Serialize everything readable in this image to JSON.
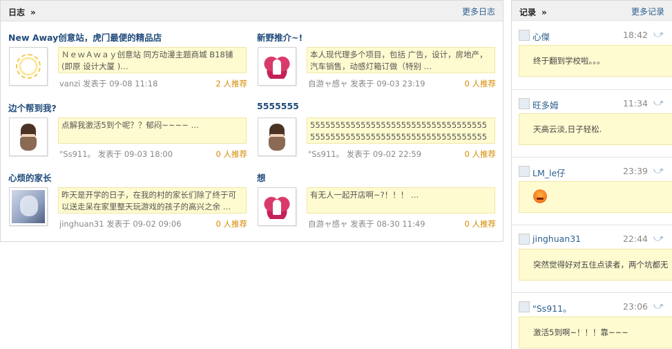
{
  "blog": {
    "title": "日志",
    "arrows": "»",
    "more": "更多日志",
    "posts": [
      {
        "title": "New Away创意站，虎门最便的精品店",
        "excerpt": "ＮｅｗＡｗａｙ创意站 同方动漫主题商城 B18铺(即原 设计大厦 )…",
        "author": "vanzi",
        "action": "发表于",
        "date": "09-08 11:18",
        "rec_num": "2",
        "rec_label": "人推荐",
        "avatar": "sun-icon"
      },
      {
        "title": "新野推介~!",
        "excerpt": "本人现代理多个项目，包括 广告，设计，房地产，汽车销售，动感灯箱订做（特别 …",
        "author": "自游ャ感ャ",
        "action": "发表于",
        "date": "09-03 23:19",
        "rec_num": "0",
        "rec_label": "人推荐",
        "avatar": "angel-icon"
      },
      {
        "title": "边个帮到我?",
        "excerpt": "点解我激活5到个呢？？郁闷~~~~ …",
        "author": "\"Ss911。",
        "action": "发表于",
        "date": "09-03 18:00",
        "rec_num": "0",
        "rec_label": "人推荐",
        "avatar": "boy-icon"
      },
      {
        "title": "5555555",
        "excerpt": "5555555555555555555555555555555555555555555555555555555555555555555555",
        "author": "\"Ss911。",
        "action": "发表于",
        "date": "09-02 22:59",
        "rec_num": "0",
        "rec_label": "人推荐",
        "avatar": "boy-icon"
      },
      {
        "title": "心烦的家长",
        "excerpt": "昨天是开学的日子，在我的村的家长们除了终于可以送走呆在家里整天玩游戏的孩子的高兴之余 …",
        "author": "jinghuan31",
        "action": "发表于",
        "date": "09-02 09:06",
        "rec_num": "0",
        "rec_label": "人推荐",
        "avatar": "girl-icon"
      },
      {
        "title": "想",
        "excerpt": "有无人一起开店啊~?！！！ …",
        "author": "自游ャ感ャ",
        "action": "发表于",
        "date": "08-30 11:49",
        "rec_num": "0",
        "rec_label": "人推荐",
        "avatar": "angel-icon"
      }
    ]
  },
  "records": {
    "title": "记录",
    "arrows": "»",
    "more": "更多记录",
    "items": [
      {
        "user": "心傑",
        "time": "18:42",
        "text": "终于翻到学校啦。。。",
        "icon": "user-icon"
      },
      {
        "user": "旺多姆",
        "time": "11:34",
        "text": "天高云淡,日子轻松.",
        "icon": "user-icon"
      },
      {
        "user": "LM_le仔",
        "time": "23:39",
        "text": "",
        "icon": "angry-smiley-icon"
      },
      {
        "user": "jinghuan31",
        "time": "22:44",
        "text": "突然觉得好对五住点读者，两个坑都无",
        "icon": "user-icon"
      },
      {
        "user": "\"Ss911。",
        "time": "23:06",
        "text": "激活5到啊~！！！靠~~~",
        "icon": "user-icon"
      }
    ]
  }
}
